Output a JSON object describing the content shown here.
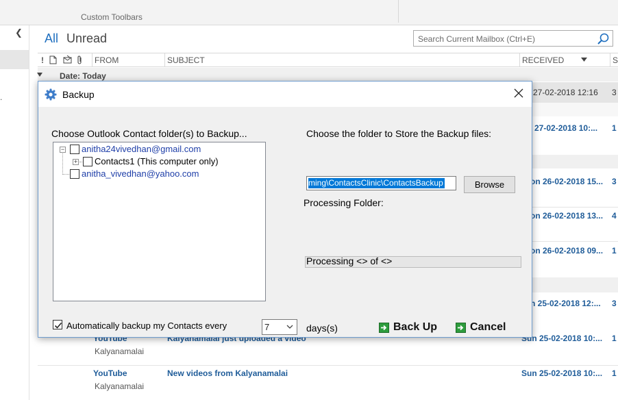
{
  "ribbon": {
    "group_label": "Custom Toolbars"
  },
  "filters": {
    "all": "All",
    "unread": "Unread"
  },
  "search": {
    "placeholder": "Search Current Mailbox (Ctrl+E)"
  },
  "columns": {
    "importance": "!",
    "from": "FROM",
    "subject": "SUBJECT",
    "received": "RECEIVED",
    "size": "S"
  },
  "group_header": "Date: Today",
  "partial_rows": [
    {
      "received": "e 27-02-2018 12:16",
      "size": "3"
    },
    {
      "received": "e 27-02-2018 10:...",
      "size": "1"
    },
    {
      "received": "on 26-02-2018 15...",
      "size": "3"
    },
    {
      "received": "on 26-02-2018 13...",
      "size": "4"
    },
    {
      "received": "on 26-02-2018 09...",
      "size": "1"
    },
    {
      "received": "n 25-02-2018 12:...",
      "size": "3"
    }
  ],
  "mails": [
    {
      "from": "YouTube",
      "subject": "Kalyanamalai just uploaded a video",
      "sender": "Kalyanamalai",
      "received": "Sun 25-02-2018 10:...",
      "size": "1"
    },
    {
      "from": "YouTube",
      "subject": "New videos from Kalyanamalai",
      "sender": "Kalyanamalai",
      "received": "Sun 25-02-2018 10:...",
      "size": "1"
    }
  ],
  "dialog": {
    "title": "Backup",
    "choose_contacts_label": "Choose Outlook Contact folder(s) to Backup...",
    "tree": [
      {
        "label": "anitha24vivedhan@gmail.com"
      },
      {
        "label": "Contacts1 (This computer only)"
      },
      {
        "label": "anitha_vivedhan@yahoo.com"
      }
    ],
    "choose_folder_label": "Choose the folder to Store the Backup files:",
    "backup_path": "ming\\ContactsClinic\\ContactsBackup",
    "browse_label": "Browse",
    "processing_folder_label": "Processing Folder:",
    "processing_status": "Processing <> of <>",
    "auto_backup_label": "Automatically backup my Contacts every",
    "auto_backup_checked": true,
    "days_value": "7",
    "days_unit": "days(s)",
    "backup_button": "Back Up",
    "cancel_button": "Cancel"
  }
}
